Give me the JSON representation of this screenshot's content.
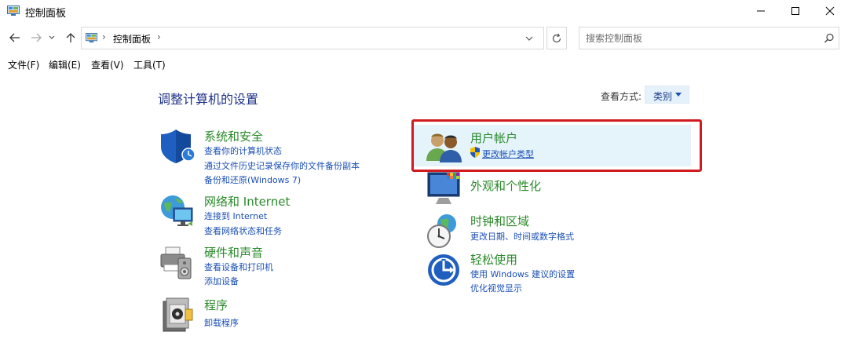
{
  "window": {
    "title": "控制面板"
  },
  "address": {
    "crumb": "控制面板",
    "separator": "›"
  },
  "search": {
    "placeholder": "搜索控制面板"
  },
  "menu": [
    "文件(F)",
    "编辑(E)",
    "查看(V)",
    "工具(T)"
  ],
  "content": {
    "heading": "调整计算机的设置",
    "view_by_label": "查看方式:",
    "view_by_value": "类别"
  },
  "left_categories": [
    {
      "title": "系统和安全",
      "links": [
        "查看你的计算机状态",
        "通过文件历史记录保存你的文件备份副本",
        "备份和还原(Windows 7)"
      ]
    },
    {
      "title": "网络和 Internet",
      "links": [
        "连接到 Internet",
        "查看网络状态和任务"
      ]
    },
    {
      "title": "硬件和声音",
      "links": [
        "查看设备和打印机",
        "添加设备"
      ]
    },
    {
      "title": "程序",
      "links": [
        "卸载程序"
      ]
    }
  ],
  "right_categories": [
    {
      "title": "用户帐户",
      "links": [
        "更改帐户类型"
      ]
    },
    {
      "title": "外观和个性化",
      "links": []
    },
    {
      "title": "时钟和区域",
      "links": [
        "更改日期、时间或数字格式"
      ]
    },
    {
      "title": "轻松使用",
      "links": [
        "使用 Windows 建议的设置",
        "优化视觉显示"
      ]
    }
  ],
  "colors": {
    "heading": "#1e3287",
    "category_title": "#2a8a2a",
    "link": "#1a4fb4",
    "highlight_border": "#d11a1f"
  }
}
